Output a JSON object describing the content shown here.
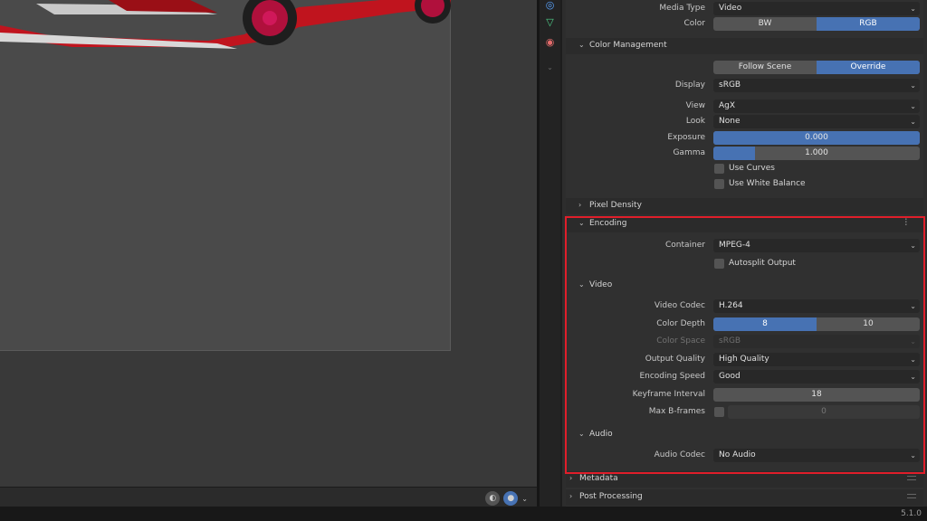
{
  "output": {
    "media_type_label": "Media Type",
    "media_type_value": "Video",
    "color_label": "Color",
    "color_options": [
      "BW",
      "RGB"
    ],
    "color_selected": "RGB"
  },
  "color_management": {
    "title": "Color Management",
    "mode_options": [
      "Follow Scene",
      "Override"
    ],
    "mode_selected": "Override",
    "display_label": "Display",
    "display_value": "sRGB",
    "view_label": "View",
    "view_value": "AgX",
    "look_label": "Look",
    "look_value": "None",
    "exposure_label": "Exposure",
    "exposure_value": "0.000",
    "gamma_label": "Gamma",
    "gamma_value": "1.000",
    "use_curves_label": "Use Curves",
    "use_white_balance_label": "Use White Balance"
  },
  "pixel_density": {
    "title": "Pixel Density"
  },
  "encoding": {
    "title": "Encoding",
    "container_label": "Container",
    "container_value": "MPEG-4",
    "autosplit_label": "Autosplit Output"
  },
  "video": {
    "title": "Video",
    "codec_label": "Video Codec",
    "codec_value": "H.264",
    "color_depth_label": "Color Depth",
    "color_depth_options": [
      "8",
      "10"
    ],
    "color_depth_selected": "8",
    "color_space_label": "Color Space",
    "color_space_value": "sRGB",
    "output_quality_label": "Output Quality",
    "output_quality_value": "High Quality",
    "encoding_speed_label": "Encoding Speed",
    "encoding_speed_value": "Good",
    "keyframe_label": "Keyframe Interval",
    "keyframe_value": "18",
    "max_bframes_label": "Max B-frames",
    "max_bframes_value": "0"
  },
  "audio": {
    "title": "Audio",
    "codec_label": "Audio Codec",
    "codec_value": "No Audio"
  },
  "metadata": {
    "title": "Metadata"
  },
  "post_processing": {
    "title": "Post Processing"
  },
  "version": "5.1.0",
  "colors": {
    "accent": "#4772b3",
    "highlight_box": "#e01e2a",
    "car_body": "#c0141e"
  },
  "icons": [
    "physics-icon",
    "object-data-icon",
    "material-icon",
    "chevron-down-icon",
    "viewport-shading-icon",
    "overlay-icon",
    "preset-icon"
  ]
}
